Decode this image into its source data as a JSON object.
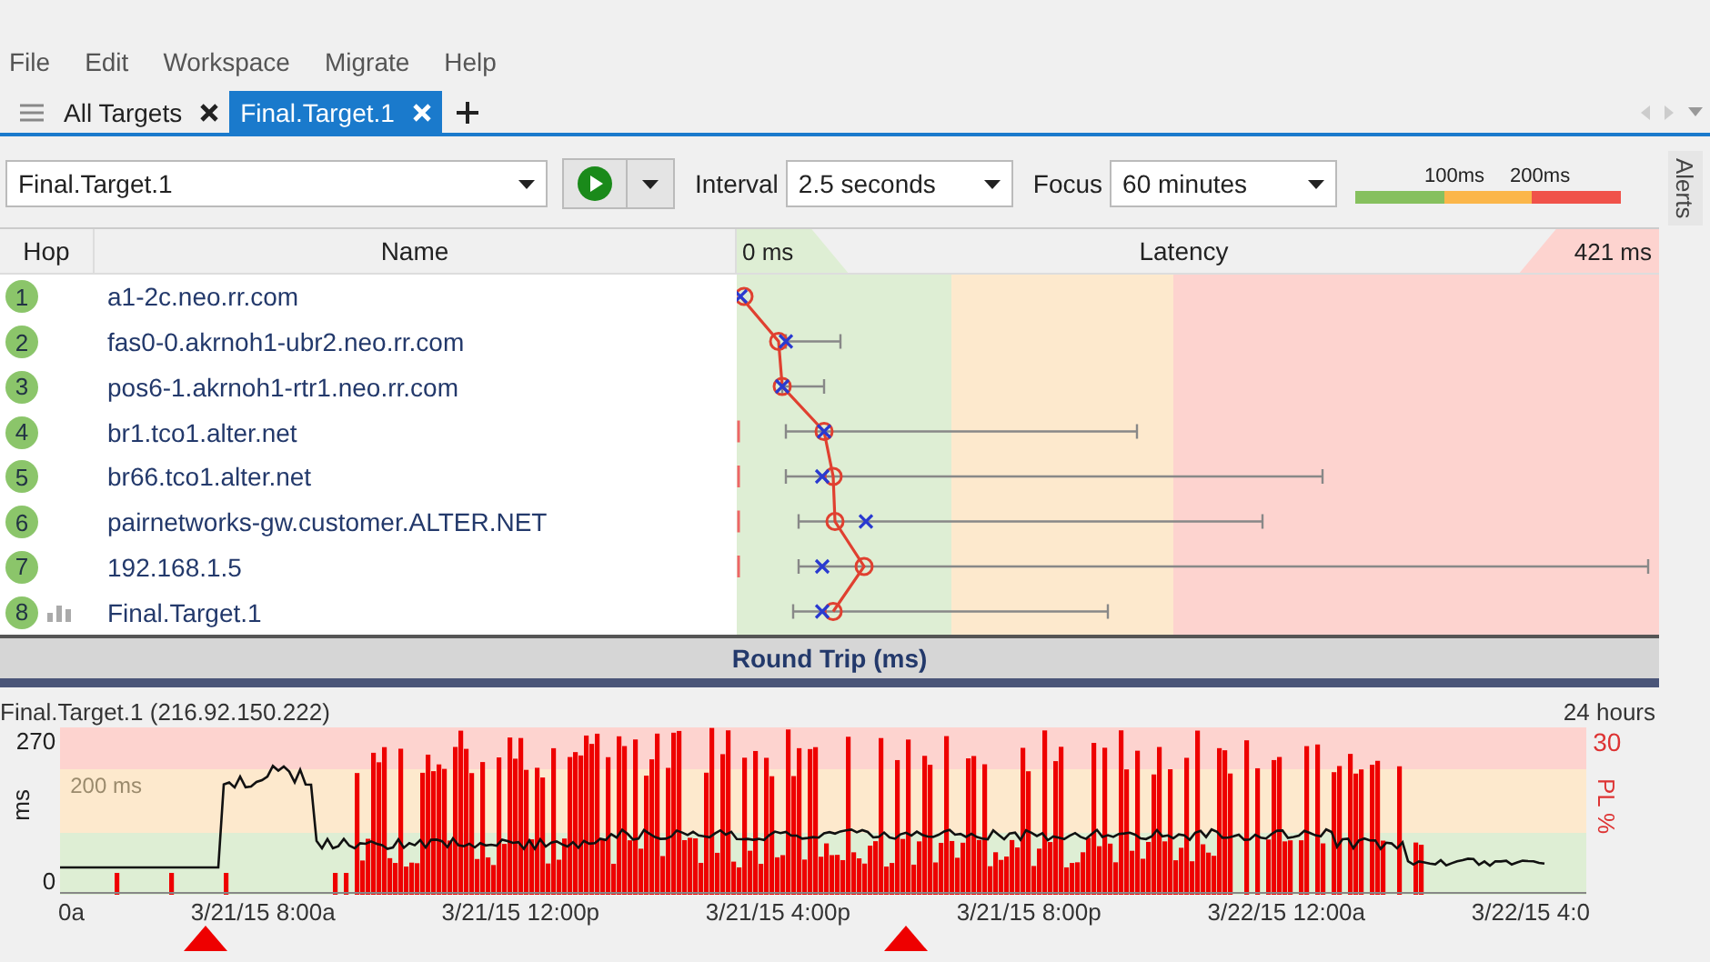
{
  "menu": [
    "File",
    "Edit",
    "Workspace",
    "Migrate",
    "Help"
  ],
  "tabs": [
    {
      "label": "All Targets",
      "selected": false,
      "kind": "list"
    },
    {
      "label": "Final.Target.1",
      "selected": true,
      "kind": "target"
    }
  ],
  "toolbar": {
    "target": "Final.Target.1",
    "interval_label": "Interval",
    "interval": "2.5 seconds",
    "focus_label": "Focus",
    "focus": "60 minutes",
    "legend": [
      "100ms",
      "200ms"
    ]
  },
  "side_tab": "Alerts",
  "table": {
    "columns": [
      "Hop",
      "Name",
      "Latency"
    ],
    "latency_min": "0 ms",
    "latency_max": "421 ms",
    "rows": [
      {
        "hop": "1",
        "name": "a1-2c.neo.rr.com",
        "graph": false
      },
      {
        "hop": "2",
        "name": "fas0-0.akrnoh1-ubr2.neo.rr.com",
        "graph": false
      },
      {
        "hop": "3",
        "name": "pos6-1.akrnoh1-rtr1.neo.rr.com",
        "graph": false
      },
      {
        "hop": "4",
        "name": "br1.tco1.alter.net",
        "graph": false
      },
      {
        "hop": "5",
        "name": "br66.tco1.alter.net",
        "graph": false
      },
      {
        "hop": "6",
        "name": "pairnetworks-gw.customer.ALTER.NET",
        "graph": false
      },
      {
        "hop": "7",
        "name": "192.168.1.5",
        "graph": false
      },
      {
        "hop": "8",
        "name": "Final.Target.1",
        "graph": true
      }
    ]
  },
  "round_trip": {
    "title": "Round Trip (ms)",
    "target": "Final.Target.1 (216.92.150.222)",
    "span": "24 hours",
    "y_label": "ms",
    "y_max": "270",
    "y_min": "0",
    "threshold": "200 ms",
    "pl_max": "30",
    "pl_label": "PL %",
    "x_labels": [
      "0a",
      "3/21/15 8:00a",
      "3/21/15 12:00p",
      "3/21/15 4:00p",
      "3/21/15 8:00p",
      "3/22/15 12:00a",
      "3/22/15 4:0"
    ]
  }
}
